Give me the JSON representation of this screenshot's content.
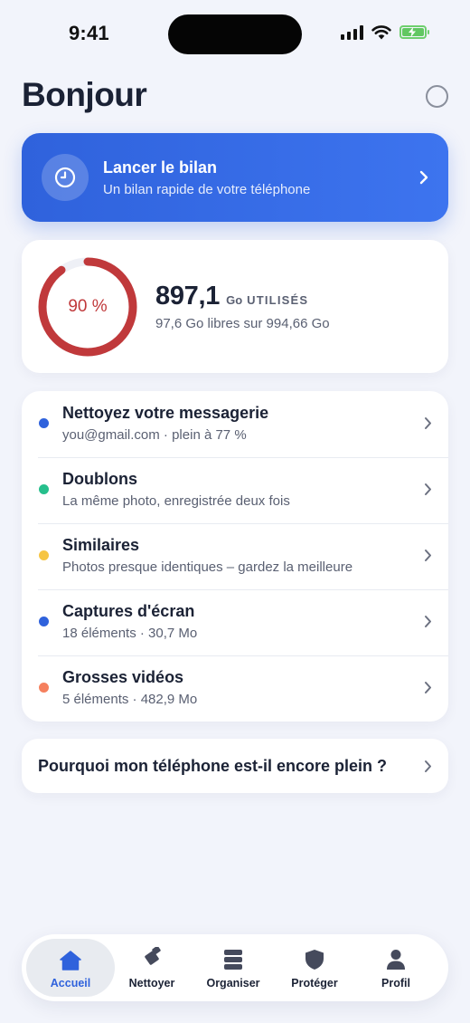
{
  "status_bar": {
    "time": "9:41",
    "icons": [
      "cellular-signal-icon",
      "wifi-icon",
      "battery-charging-icon"
    ]
  },
  "header": {
    "greeting": "Bonjour",
    "right_icon": "circle-icon"
  },
  "scan_card": {
    "title": "Lancer le bilan",
    "subtitle": "Un bilan rapide de votre téléphone",
    "icon": "clock-icon",
    "accent": "#2f62dc"
  },
  "storage": {
    "percent_label": "90 %",
    "used_fraction": 0.9,
    "used_value": "897,1",
    "used_unit": "Go",
    "used_label": "UTILISÉS",
    "free_text": "97,6 Go libres sur 994,66 Go",
    "ring_color": "#c0393b"
  },
  "list": {
    "items": [
      {
        "title": "Nettoyez votre messagerie",
        "subtitle": "you@gmail.com · plein à 77 %",
        "dot_color": "#2f62dc"
      },
      {
        "title": "Doublons",
        "subtitle": "La même photo, enregistrée deux fois",
        "dot_color": "#26bf8c"
      },
      {
        "title": "Similaires",
        "subtitle": "Photos presque identiques – gardez la meilleure",
        "dot_color": "#f6c544"
      },
      {
        "title": "Captures d'écran",
        "subtitle": "18 éléments · 30,7 Mo",
        "dot_color": "#2f62dc"
      },
      {
        "title": "Grosses vidéos",
        "subtitle": "5 éléments · 482,9 Mo",
        "dot_color": "#f5805e"
      }
    ]
  },
  "faq": {
    "label": "Pourquoi mon téléphone est-il encore plein ?"
  },
  "tab_bar": {
    "tabs": [
      {
        "label": "Accueil",
        "icon": "home-icon",
        "active": true
      },
      {
        "label": "Nettoyer",
        "icon": "eraser-icon",
        "active": false
      },
      {
        "label": "Organiser",
        "icon": "stack-icon",
        "active": false
      },
      {
        "label": "Protéger",
        "icon": "shield-icon",
        "active": false
      },
      {
        "label": "Profil",
        "icon": "person-icon",
        "active": false
      }
    ],
    "active_color": "#2f62dc"
  }
}
